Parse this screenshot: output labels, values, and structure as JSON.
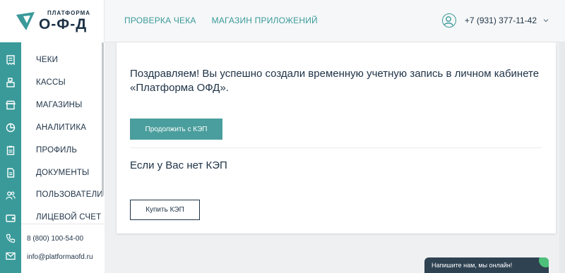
{
  "brand": {
    "top_text": "ПЛАТФОРМА",
    "main_text": "О-Ф-Д"
  },
  "header": {
    "nav": [
      {
        "label": "ПРОВЕРКА ЧЕКА"
      },
      {
        "label": "МАГАЗИН ПРИЛОЖЕНИЙ"
      }
    ],
    "user_phone": "+7 (931) 377-11-42"
  },
  "sidebar": {
    "items": [
      {
        "label": "ЧЕКИ",
        "icon": "receipt-icon"
      },
      {
        "label": "КАССЫ",
        "icon": "cash-register-icon"
      },
      {
        "label": "МАГАЗИНЫ",
        "icon": "store-icon"
      },
      {
        "label": "АНАЛИТИКА",
        "icon": "pie-chart-icon"
      },
      {
        "label": "ПРОФИЛЬ",
        "icon": "clipboard-icon"
      },
      {
        "label": "ДОКУМЕНТЫ",
        "icon": "document-icon"
      },
      {
        "label": "ПОЛЬЗОВАТЕЛИ",
        "icon": "users-icon"
      },
      {
        "label": "ЛИЦЕВОЙ СЧЕТ",
        "icon": "wallet-icon"
      }
    ],
    "contacts": {
      "phone": "8 (800) 100-54-00",
      "email": "info@platformaofd.ru"
    }
  },
  "main": {
    "message": "Поздравляем! Вы успешно создали временную учетную запись в личном кабинете «Платформа ОФД».",
    "continue_button": "Продолжить с КЭП",
    "no_kep_text": "Если у Вас нет КЭП",
    "buy_button": "Купить КЭП"
  },
  "chat": {
    "label": "Напишите нам, мы онлайн!"
  },
  "colors": {
    "accent": "#3a9a9a",
    "text_dark": "#1e3246",
    "chat_bg": "#2f4252",
    "online": "#4cc07a"
  }
}
